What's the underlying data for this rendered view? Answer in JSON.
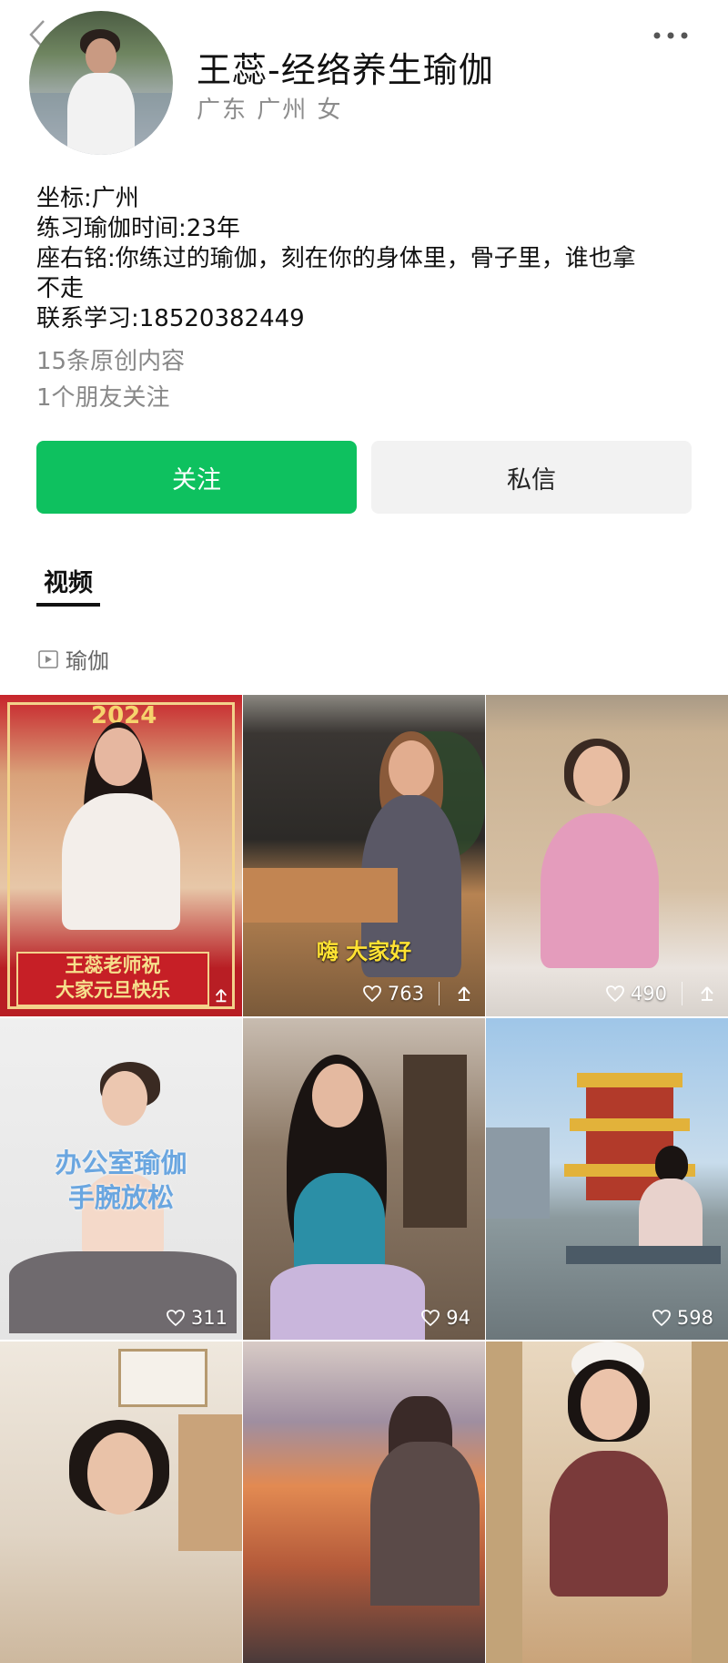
{
  "profile": {
    "name": "王蕊-经络养生瑜伽",
    "subtitle": "广东 广州 女",
    "bio_lines": [
      "坐标:广州",
      "练习瑜伽时间:23年",
      "座右铭:你练过的瑜伽，刻在你的身体里，骨子里，谁也拿\n不走",
      "联系学习:18520382449"
    ],
    "original_count": "15条原创内容",
    "friends_follow": "1个朋友关注"
  },
  "actions": {
    "follow": "关注",
    "message": "私信"
  },
  "tabs": {
    "videos": "视频"
  },
  "collection": {
    "label": "瑜伽"
  },
  "videos": [
    {
      "caption": "王蕊老师祝\n大家元旦快乐",
      "likes": "",
      "badge": "2024",
      "theme": "red",
      "top_text": ""
    },
    {
      "caption": "嗨 大家好",
      "likes": "763",
      "theme": "cafe",
      "top_text": ""
    },
    {
      "caption": "",
      "likes": "490",
      "theme": "pink",
      "top_text": ""
    },
    {
      "caption": "",
      "likes": "311",
      "theme": "office",
      "top_text": "办公室瑜伽\n手腕放松"
    },
    {
      "caption": "",
      "likes": "94",
      "theme": "hall",
      "top_text": ""
    },
    {
      "caption": "",
      "likes": "598",
      "theme": "pagoda",
      "top_text": ""
    },
    {
      "caption": "",
      "likes": "",
      "theme": "room",
      "top_text": ""
    },
    {
      "caption": "",
      "likes": "",
      "theme": "sunset",
      "top_text": ""
    },
    {
      "caption": "",
      "likes": "",
      "theme": "shelf",
      "top_text": ""
    }
  ],
  "colors": {
    "accent": "#0ec15f",
    "muted": "#8c8c8c"
  }
}
